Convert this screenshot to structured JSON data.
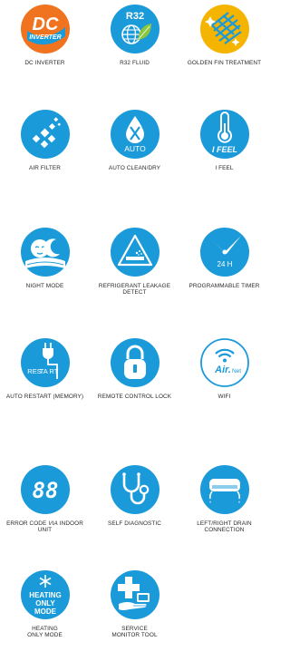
{
  "brand_colors": {
    "blue": "#1a9ad9",
    "orange": "#f0731f",
    "gold": "#f5b400",
    "white": "#ffffff"
  },
  "features": [
    {
      "label": "DC INVERTER",
      "icon": "dc-inverter-icon",
      "text": [
        "DC",
        "INVERTER"
      ]
    },
    {
      "label": "R32 FLUID",
      "icon": "r32-globe-leaf-icon",
      "text": [
        "R32"
      ]
    },
    {
      "label": "GOLDEN FIN TREATMENT",
      "icon": "golden-fin-icon"
    },
    {
      "label": "AIR FILTER",
      "icon": "air-filter-icon"
    },
    {
      "label": "AUTO CLEAN/DRY",
      "icon": "auto-clean-drop-icon",
      "text": [
        "AUTO"
      ]
    },
    {
      "label": "I FEEL",
      "icon": "thermometer-icon",
      "text": [
        "I FEEL"
      ]
    },
    {
      "label": "NIGHT MODE",
      "icon": "night-mode-moon-icon"
    },
    {
      "label": "REFRIGERANT LEAKAGE DETECT",
      "icon": "leak-warning-icon"
    },
    {
      "label": "PROGRAMMABLE TIMER",
      "icon": "timer-clock-icon",
      "text": [
        "24 H"
      ]
    },
    {
      "label": "AUTO RESTART (MEMORY)",
      "icon": "plug-restart-icon",
      "text": [
        "RES",
        "TA RT"
      ]
    },
    {
      "label": "REMOTE CONTROL LOCK",
      "icon": "padlock-icon"
    },
    {
      "label": "WIFI",
      "icon": "wifi-icon",
      "text": [
        "Air.",
        "Net"
      ]
    },
    {
      "label_parts": [
        "ERROR CODE ",
        "VIA",
        " INDOOR UNIT"
      ],
      "icon": "error-code-display-icon",
      "text": [
        "88"
      ]
    },
    {
      "label": "SELF DIAGNOSTIC",
      "icon": "stethoscope-icon"
    },
    {
      "label": "LEFT/RIGHT DRAIN CONNECTION",
      "icon": "drain-unit-icon"
    },
    {
      "label": "HEATING ONLY MODE",
      "icon": "snowflake-heating-icon",
      "text": [
        "HEATING",
        "ONLY",
        "MODE"
      ]
    },
    {
      "label": "SERVICE MONITOR TOOL",
      "icon": "service-monitor-icon"
    }
  ]
}
